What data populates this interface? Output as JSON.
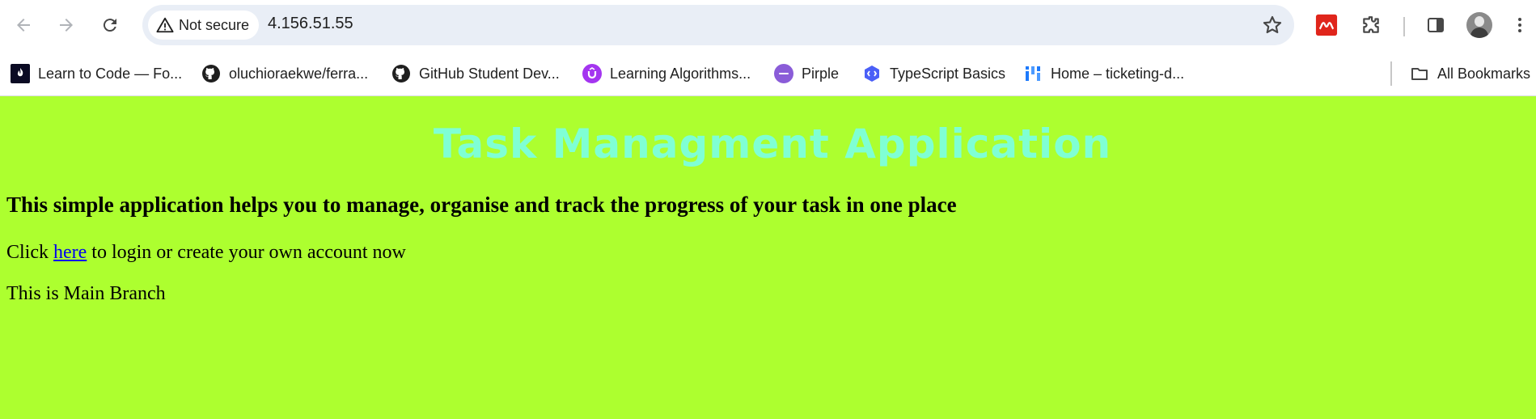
{
  "browser": {
    "security_label": "Not secure",
    "url": "4.156.51.55",
    "bookmarks": [
      {
        "label": "Learn to Code — Fo...",
        "icon": "freecodecamp-icon"
      },
      {
        "label": "oluchioraekwe/ferra...",
        "icon": "github-icon"
      },
      {
        "label": "GitHub Student Dev...",
        "icon": "github-icon"
      },
      {
        "label": "Learning Algorithms...",
        "icon": "udemy-icon"
      },
      {
        "label": "Pirple",
        "icon": "pirple-icon"
      },
      {
        "label": "TypeScript Basics",
        "icon": "typescript-basics-icon"
      },
      {
        "label": "Home – ticketing-d...",
        "icon": "jira-icon"
      }
    ],
    "all_bookmarks_label": "All Bookmarks"
  },
  "page": {
    "background": "#adff2f",
    "title": "Task Managment Application",
    "title_color": "#7fffd4",
    "subtitle": "This simple application helps you to manage, organise and track the progress of your task in one place",
    "login_prefix": "Click ",
    "login_link": "here",
    "login_suffix": " to login or create your own account now",
    "branch_text": "This is Main Branch"
  }
}
